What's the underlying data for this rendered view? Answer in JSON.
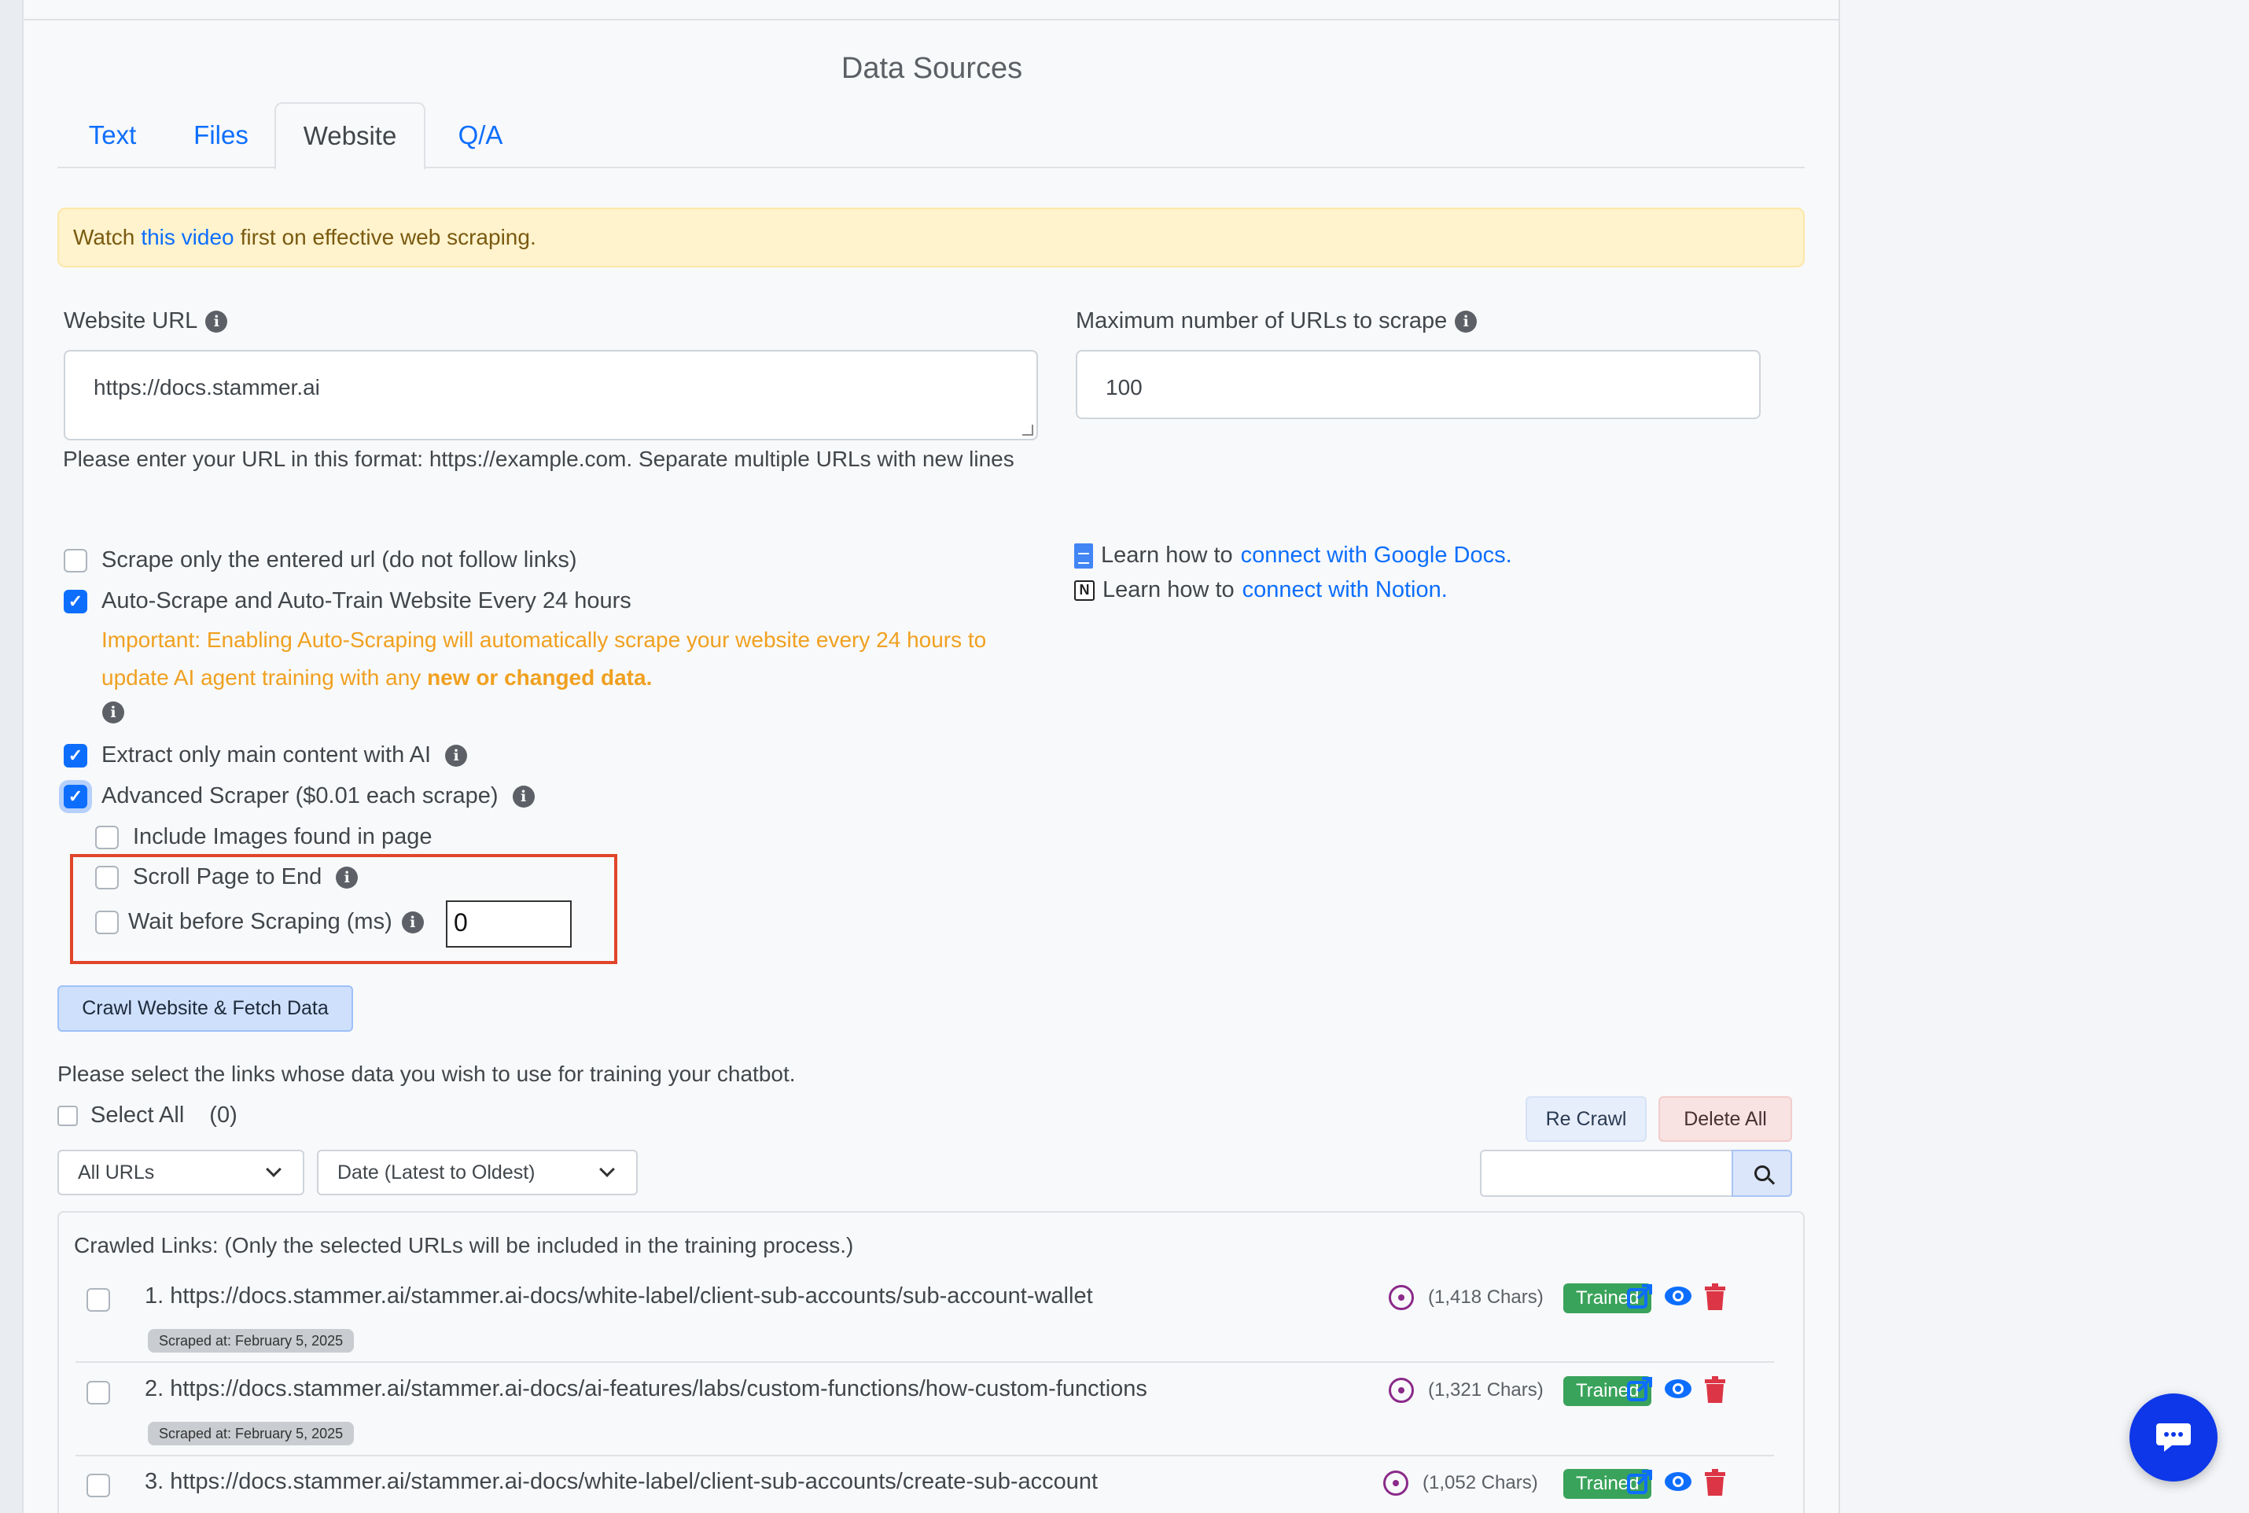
{
  "page_title": "Data Sources",
  "tabs": [
    {
      "label": "Text",
      "active": false
    },
    {
      "label": "Files",
      "active": false
    },
    {
      "label": "Website",
      "active": true
    },
    {
      "label": "Q/A",
      "active": false
    }
  ],
  "alert": {
    "before": "Watch",
    "link": "this video",
    "after": "first on effective web scraping."
  },
  "website_url": {
    "label": "Website URL",
    "value": "https://docs.stammer.ai",
    "help": "Please enter your URL in this format: https://example.com. Separate multiple URLs with new lines"
  },
  "max_urls": {
    "label": "Maximum number of URLs to scrape",
    "value": "100"
  },
  "options": {
    "scrape_only": {
      "label": "Scrape only the entered url (do not follow links)",
      "checked": false
    },
    "auto_scrape": {
      "label": "Auto-Scrape and Auto-Train Website Every 24 hours",
      "checked": true
    },
    "auto_warning": "Important: Enabling Auto-Scraping will automatically scrape your website every 24 hours to update AI agent training with any",
    "auto_warning_bold": "new or changed data.",
    "extract_main": {
      "label": "Extract only main content with AI",
      "checked": true
    },
    "advanced": {
      "label": "Advanced Scraper ($0.01 each scrape)",
      "checked": true
    },
    "include_images": {
      "label": "Include Images found in page",
      "checked": false
    },
    "scroll_end": {
      "label": "Scroll Page to End",
      "checked": false
    },
    "wait_before": {
      "label": "Wait before Scraping (ms)",
      "checked": false,
      "value": "0"
    }
  },
  "learn": {
    "google": {
      "prefix": "Learn how to",
      "link": "connect with Google Docs."
    },
    "notion": {
      "prefix": "Learn how to",
      "link": "connect with Notion."
    }
  },
  "crawl_button": "Crawl Website & Fetch Data",
  "select_prompt": "Please select the links whose data you wish to use for training your chatbot.",
  "select_all": {
    "label": "Select All",
    "count": "(0)"
  },
  "recrawl_button": "Re Crawl",
  "delete_all_button": "Delete All",
  "filter_dropdown": "All URLs",
  "sort_dropdown": "Date (Latest to Oldest)",
  "search": {
    "placeholder": ""
  },
  "crawled_header": "Crawled Links: (Only the selected URLs will be included in the training process.)",
  "links": [
    {
      "text": "1. https://docs.stammer.ai/stammer.ai-docs/white-label/client-sub-accounts/sub-account-wallet",
      "scraped": "Scraped at: February 5, 2025",
      "chars": "(1,418 Chars)",
      "status": "Trained"
    },
    {
      "text": "2. https://docs.stammer.ai/stammer.ai-docs/ai-features/labs/custom-functions/how-custom-functions",
      "scraped": "Scraped at: February 5, 2025",
      "chars": "(1,321 Chars)",
      "status": "Trained"
    },
    {
      "text": "3. https://docs.stammer.ai/stammer.ai-docs/white-label/client-sub-accounts/create-sub-account",
      "scraped": "",
      "chars": "(1,052 Chars)",
      "status": "Trained"
    }
  ],
  "colors": {
    "primary": "#0d6efd",
    "success": "#3aa35b",
    "danger": "#dc3545",
    "warning_text": "#f0a020",
    "highlight": "#e0452a",
    "fab": "#0d37e8"
  }
}
